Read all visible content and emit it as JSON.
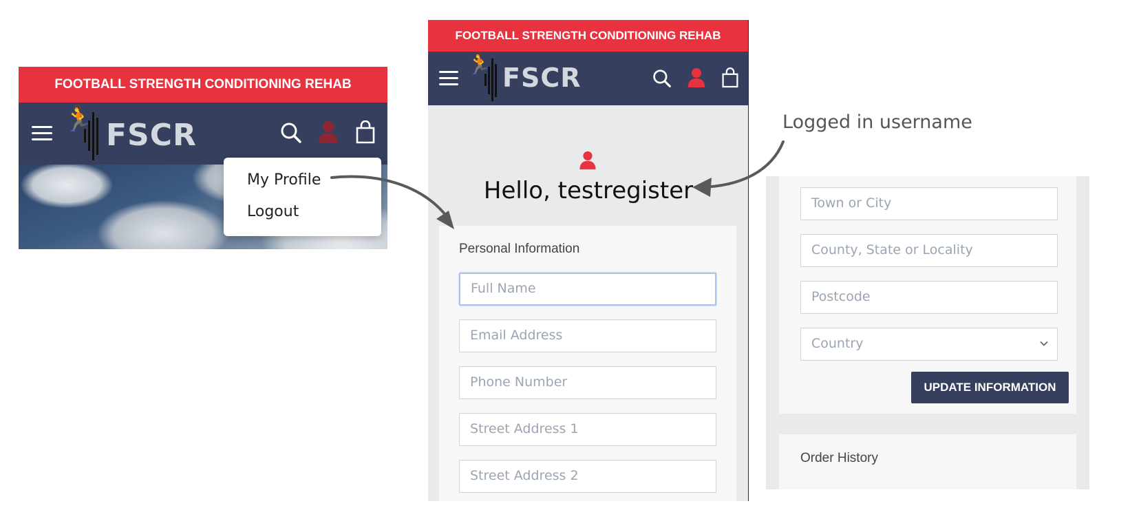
{
  "brand": {
    "banner_text": "FOOTBALL STRENGTH CONDITIONING REHAB",
    "logo_text": "FSCR",
    "colors": {
      "banner": "#e8323f",
      "navbar": "#363f5d",
      "accent": "#e8323f",
      "page_bg": "#e9eaec"
    }
  },
  "panel1": {
    "icons": [
      "hamburger-icon",
      "logo",
      "search-icon",
      "user-icon",
      "shopping-bag-icon"
    ],
    "dropdown": {
      "items": [
        "My Profile",
        "Logout"
      ]
    }
  },
  "panel2": {
    "greeting": "Hello, testregister",
    "section_title": "Personal Information",
    "fields": [
      {
        "placeholder": "Full Name",
        "focused": true
      },
      {
        "placeholder": "Email Address"
      },
      {
        "placeholder": "Phone Number"
      },
      {
        "placeholder": "Street Address 1"
      },
      {
        "placeholder": "Street Address 2"
      }
    ]
  },
  "panel3": {
    "fields": [
      {
        "placeholder": "Town or City"
      },
      {
        "placeholder": "County, State or Locality"
      },
      {
        "placeholder": "Postcode"
      }
    ],
    "country_select": {
      "selected": "Country"
    },
    "update_button": "UPDATE INFORMATION",
    "order_history_title": "Order History"
  },
  "annotation": {
    "text": "Logged in username"
  }
}
